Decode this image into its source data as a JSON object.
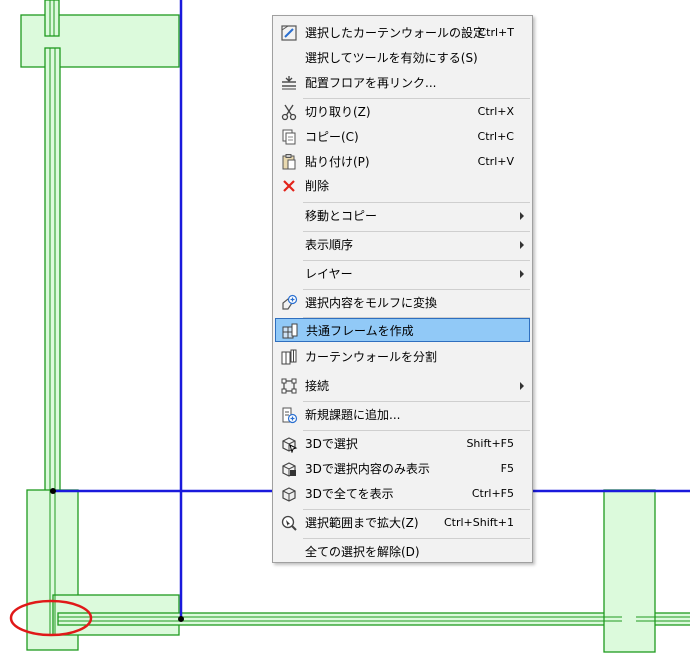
{
  "colors": {
    "element_fill": "#dcfadc",
    "element_stroke": "#1f9a1f",
    "grid_line": "#1a1adc",
    "marker": "#e01919",
    "menu_bg": "#f2f2f2",
    "highlight": "#91c9f7"
  },
  "context_menu": {
    "items": [
      {
        "label": "選択したカーテンウォールの設定",
        "shortcut": "Ctrl+T",
        "icon": "curtain-wall-settings-icon"
      },
      {
        "label": "選択してツールを有効にする(S)",
        "shortcut": "",
        "icon": ""
      },
      {
        "label": "配置フロアを再リンク...",
        "shortcut": "",
        "icon": "relink-floor-icon"
      },
      {
        "label": "切り取り(Z)",
        "shortcut": "Ctrl+X",
        "icon": "scissors-icon"
      },
      {
        "label": "コピー(C)",
        "shortcut": "Ctrl+C",
        "icon": "copy-icon"
      },
      {
        "label": "貼り付け(P)",
        "shortcut": "Ctrl+V",
        "icon": "paste-icon"
      },
      {
        "label": "削除",
        "shortcut": "",
        "icon": "delete-x-icon"
      },
      {
        "label": "移動とコピー",
        "shortcut": "",
        "icon": "",
        "submenu": true
      },
      {
        "label": "表示順序",
        "shortcut": "",
        "icon": "",
        "submenu": true
      },
      {
        "label": "レイヤー",
        "shortcut": "",
        "icon": "",
        "submenu": true
      },
      {
        "label": "選択内容をモルフに変換",
        "shortcut": "",
        "icon": "convert-morph-icon"
      },
      {
        "label": "共通フレームを作成",
        "shortcut": "",
        "icon": "common-frame-icon",
        "highlighted": true
      },
      {
        "label": "カーテンウォールを分割",
        "shortcut": "",
        "icon": "split-curtain-wall-icon"
      },
      {
        "label": "接続",
        "shortcut": "",
        "icon": "connect-icon",
        "submenu": true
      },
      {
        "label": "新規課題に追加...",
        "shortcut": "",
        "icon": "add-issue-icon"
      },
      {
        "label": "3Dで選択",
        "shortcut": "Shift+F5",
        "icon": "select-3d-icon"
      },
      {
        "label": "3Dで選択内容のみ表示",
        "shortcut": "F5",
        "icon": "show-selection-3d-icon"
      },
      {
        "label": "3Dで全てを表示",
        "shortcut": "Ctrl+F5",
        "icon": "show-all-3d-icon"
      },
      {
        "label": "選択範囲まで拡大(Z)",
        "shortcut": "Ctrl+Shift+1",
        "icon": "zoom-selection-icon"
      },
      {
        "label": "全ての選択を解除(D)",
        "shortcut": "",
        "icon": ""
      }
    ]
  }
}
